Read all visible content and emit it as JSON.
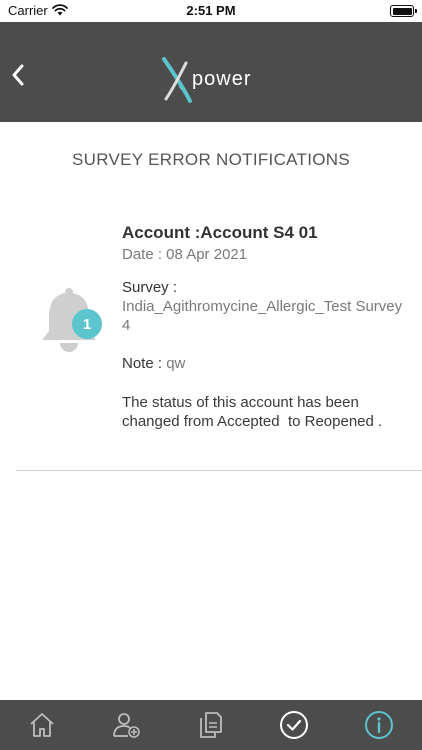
{
  "status_bar": {
    "carrier": "Carrier",
    "time": "2:51 PM"
  },
  "header": {
    "logo_text": "power",
    "back_icon": "chevron-left-icon",
    "background": "#4c4c4c"
  },
  "page": {
    "title": "SURVEY ERROR NOTIFICATIONS"
  },
  "notification": {
    "badge_count": "1",
    "account_label": "Account :",
    "account_value": "Account S4 01",
    "date_text": "Date : 08 Apr 2021",
    "survey_label": "Survey :",
    "survey_value": "India_Agithromycine_Allergic_Test Survey 4",
    "note_label": "Note :",
    "note_value": "qw",
    "message": "The status of this account has been changed from Accepted  to Reopened ."
  },
  "colors": {
    "accent": "#5cc4cc",
    "bar_background": "#4c4c4c"
  },
  "tab_bar": {
    "items": [
      {
        "icon": "home-icon"
      },
      {
        "icon": "add-user-icon"
      },
      {
        "icon": "documents-icon"
      },
      {
        "icon": "check-circle-icon"
      },
      {
        "icon": "info-icon",
        "active": true
      }
    ]
  }
}
